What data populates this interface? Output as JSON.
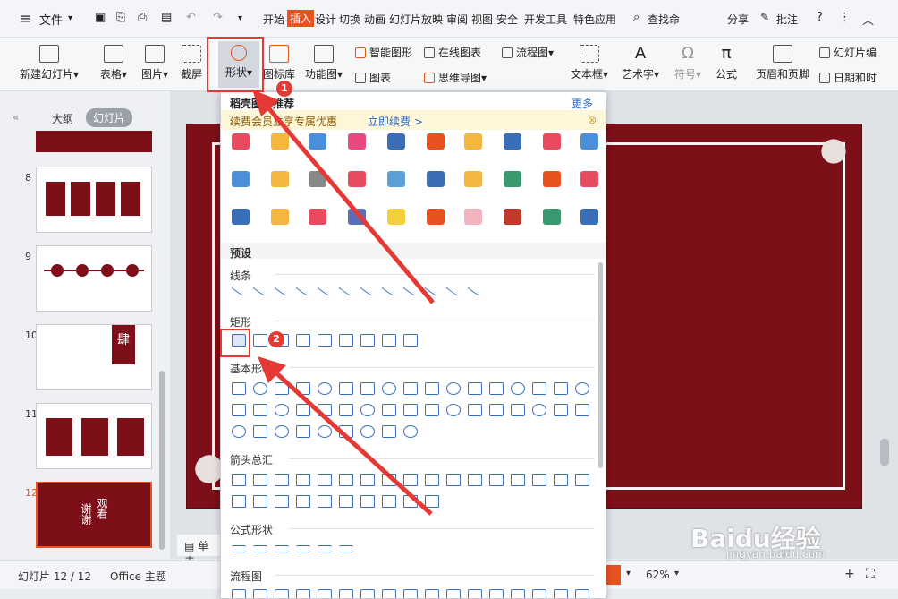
{
  "titlebar": {
    "menu_file": "文件",
    "tabs": [
      "开始",
      "插入",
      "设计",
      "切换",
      "动画",
      "幻灯片放映",
      "审阅",
      "视图",
      "安全",
      "开发工具",
      "特色应用"
    ],
    "search": "查找命",
    "share": "分享",
    "comment": "批注",
    "help": "?"
  },
  "ribbon": {
    "new_slide": "新建幻灯片",
    "table": "表格",
    "image": "图片",
    "screenshot": "截屏",
    "shape": "形状",
    "icon_lib": "图标库",
    "func_chart": "功能图",
    "smart_shape": "智能图形",
    "online_chart": "在线图表",
    "flowchart": "流程图",
    "chart": "图表",
    "mindmap": "思维导图",
    "textbox": "文本框",
    "art_text": "艺术字",
    "symbol": "符号",
    "formula": "公式",
    "header_footer": "页眉和页脚",
    "slide_num": "幻灯片编",
    "datetime": "日期和时"
  },
  "left_panel": {
    "tab_outline": "大纲",
    "tab_slides": "幻灯片",
    "slide_numbers": [
      "8",
      "9",
      "10",
      "11",
      "12"
    ]
  },
  "dropdown": {
    "title": "稻壳图标推荐",
    "more": "更多",
    "promo_text": "续费会员立享专属优惠",
    "promo_link": "立即续费 >",
    "preset": "预设",
    "sections": [
      "线条",
      "矩形",
      "基本形状",
      "箭头总汇",
      "公式形状",
      "流程图"
    ]
  },
  "thumb_text": {
    "s10_char": "肆",
    "s12_a": "谢谢",
    "s12_b": "观看"
  },
  "status": {
    "slide_info": "幻灯片 12 / 12",
    "theme": "Office 主题",
    "notes": "单击",
    "zoom": "62%"
  },
  "annotations": {
    "badge1": "1",
    "badge2": "2"
  },
  "watermark": {
    "brand": "Baidu经验",
    "url": "jingyan.baidu.com"
  },
  "colors": {
    "accent": "#e8521f",
    "slide_bg": "#7d0f18",
    "highlight": "#e53935",
    "shape_stroke": "#3a6fb8"
  }
}
